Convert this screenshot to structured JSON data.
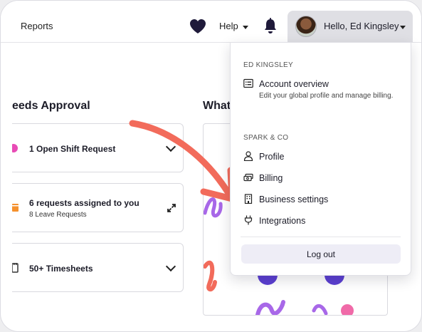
{
  "topbar": {
    "reports_label": "Reports",
    "help_label": "Help",
    "greeting": "Hello, Ed Kingsley",
    "icons": [
      "heart-icon",
      "bell-icon"
    ]
  },
  "needs_approval": {
    "title": "eeds Approval",
    "cards": [
      {
        "title": "1 Open Shift Request",
        "subtitle": ""
      },
      {
        "title": "6 requests assigned to you",
        "subtitle": "8 Leave Requests"
      },
      {
        "title": "50+ Timesheets",
        "subtitle": ""
      }
    ]
  },
  "whats_new": {
    "title": "What"
  },
  "user_menu": {
    "user_section": "ED KINGSLEY",
    "account_overview": {
      "label": "Account overview",
      "description": "Edit your global profile and manage billing."
    },
    "org_section": "SPARK & CO",
    "items": [
      {
        "label": "Profile",
        "icon": "person-icon"
      },
      {
        "label": "Billing",
        "icon": "money-icon"
      },
      {
        "label": "Business settings",
        "icon": "building-icon"
      },
      {
        "label": "Integrations",
        "icon": "plug-icon"
      }
    ],
    "logout_label": "Log out"
  },
  "colors": {
    "accent_arrow": "#f26b5b",
    "brand_purple": "#5b3fd1",
    "logout_bg": "#eeedf6"
  }
}
